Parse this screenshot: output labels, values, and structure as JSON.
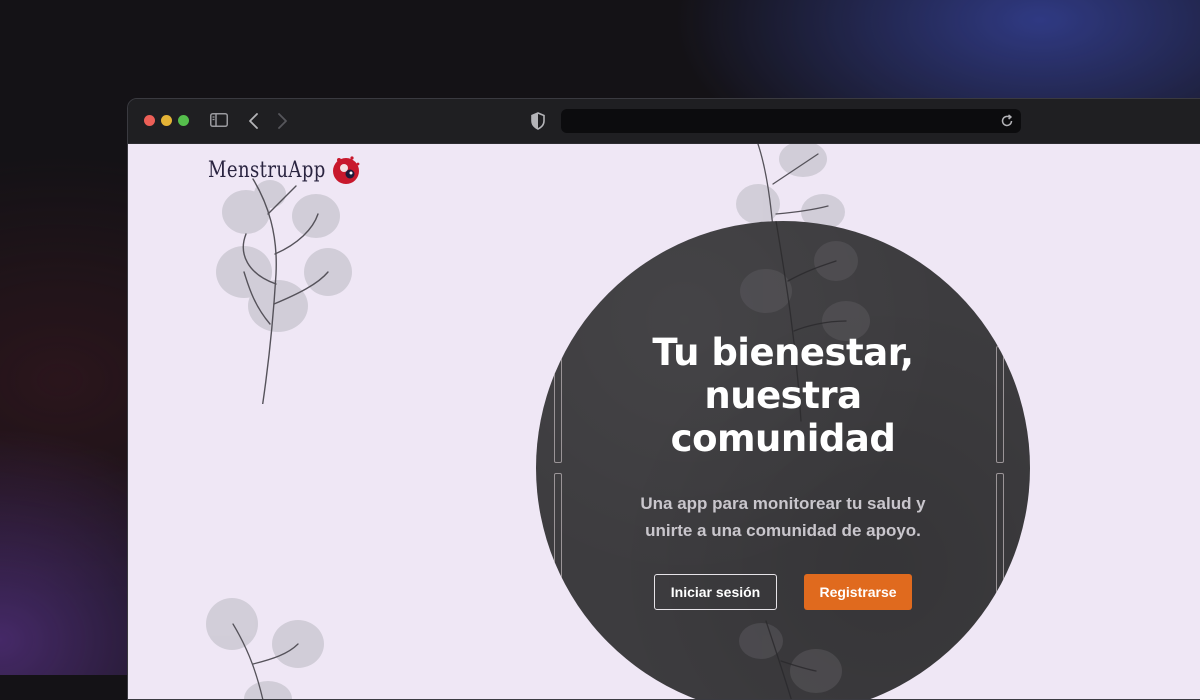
{
  "brand": {
    "name": "MenstruApp",
    "logo_icon": "red-blob-logo-icon"
  },
  "browser": {
    "window_controls": [
      "close",
      "minimize",
      "maximize"
    ],
    "address_value": ""
  },
  "hero": {
    "title_lines": [
      "Tu bienestar,",
      "nuestra",
      "comunidad"
    ],
    "subtitle_lines": [
      "Una app para monitorear tu salud y",
      "unirte a una comunidad de apoyo."
    ],
    "login_label": "Iniciar sesión",
    "register_label": "Registrarse"
  },
  "colors": {
    "page_background": "#efe7f5",
    "hero_circle": "#3d3c3f",
    "register_button": "#e06a1e",
    "brand_text": "#2a2440"
  }
}
